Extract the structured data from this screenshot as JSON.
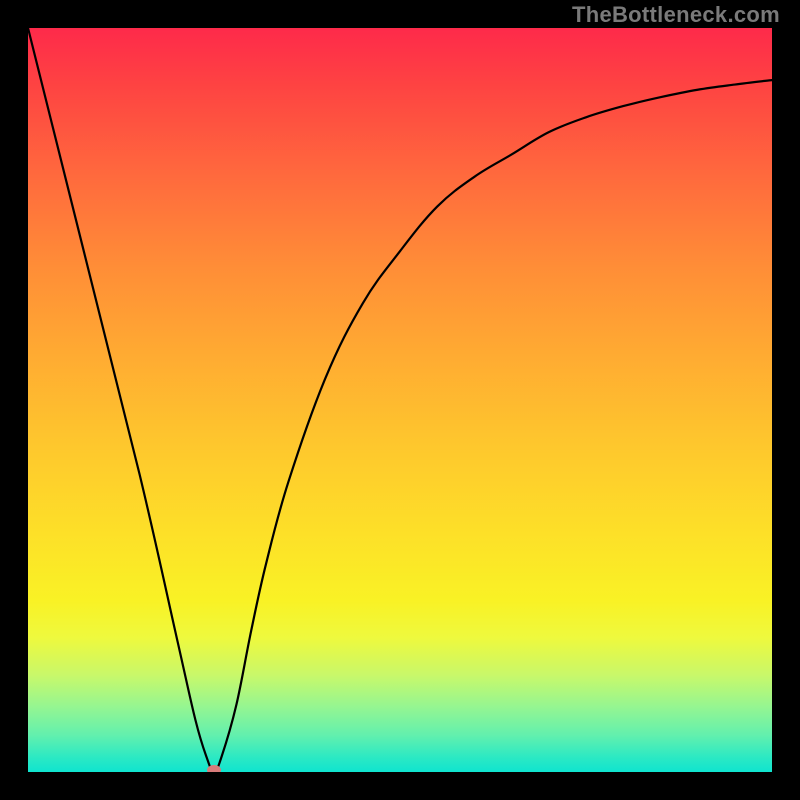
{
  "watermark": "TheBottleneck.com",
  "colors": {
    "frame": "#000000",
    "curve": "#000000",
    "marker": "#d77b7a",
    "gradient_top": "#fe2a4a",
    "gradient_bottom": "#0fe4cf"
  },
  "chart_data": {
    "type": "line",
    "title": "",
    "xlabel": "",
    "ylabel": "",
    "xlim": [
      0,
      100
    ],
    "ylim": [
      0,
      100
    ],
    "grid": false,
    "legend": false,
    "note": "Values are read off pixel positions; the chart has no visible numeric ticks so y is treated as 0 (green/bottom) to 100 (red/top).",
    "series": [
      {
        "name": "bottleneck-curve",
        "x": [
          0,
          7.5,
          15,
          20,
          22.5,
          24,
          25,
          26,
          28,
          30,
          32,
          35,
          40,
          45,
          50,
          55,
          60,
          65,
          70,
          75,
          80,
          85,
          90,
          95,
          100
        ],
        "y": [
          100,
          70,
          40,
          18,
          7,
          2,
          0,
          2,
          9,
          19,
          28,
          39,
          53,
          63,
          70,
          76,
          80,
          83,
          86,
          88,
          89.5,
          90.7,
          91.7,
          92.4,
          93
        ]
      }
    ],
    "annotations": [
      {
        "name": "marker",
        "x": 25,
        "y": 0.3
      }
    ],
    "background_gradient_stops": [
      {
        "pos": 0.0,
        "color": "#fe2a4a"
      },
      {
        "pos": 0.08,
        "color": "#fe4442"
      },
      {
        "pos": 0.2,
        "color": "#ff6a3d"
      },
      {
        "pos": 0.32,
        "color": "#ff8d37"
      },
      {
        "pos": 0.44,
        "color": "#ffab32"
      },
      {
        "pos": 0.56,
        "color": "#fec72d"
      },
      {
        "pos": 0.68,
        "color": "#fde028"
      },
      {
        "pos": 0.77,
        "color": "#f9f225"
      },
      {
        "pos": 0.82,
        "color": "#eef93e"
      },
      {
        "pos": 0.87,
        "color": "#c8f86a"
      },
      {
        "pos": 0.91,
        "color": "#98f68f"
      },
      {
        "pos": 0.95,
        "color": "#63f0ad"
      },
      {
        "pos": 0.98,
        "color": "#2ce9c3"
      },
      {
        "pos": 1.0,
        "color": "#0fe4cf"
      }
    ]
  }
}
